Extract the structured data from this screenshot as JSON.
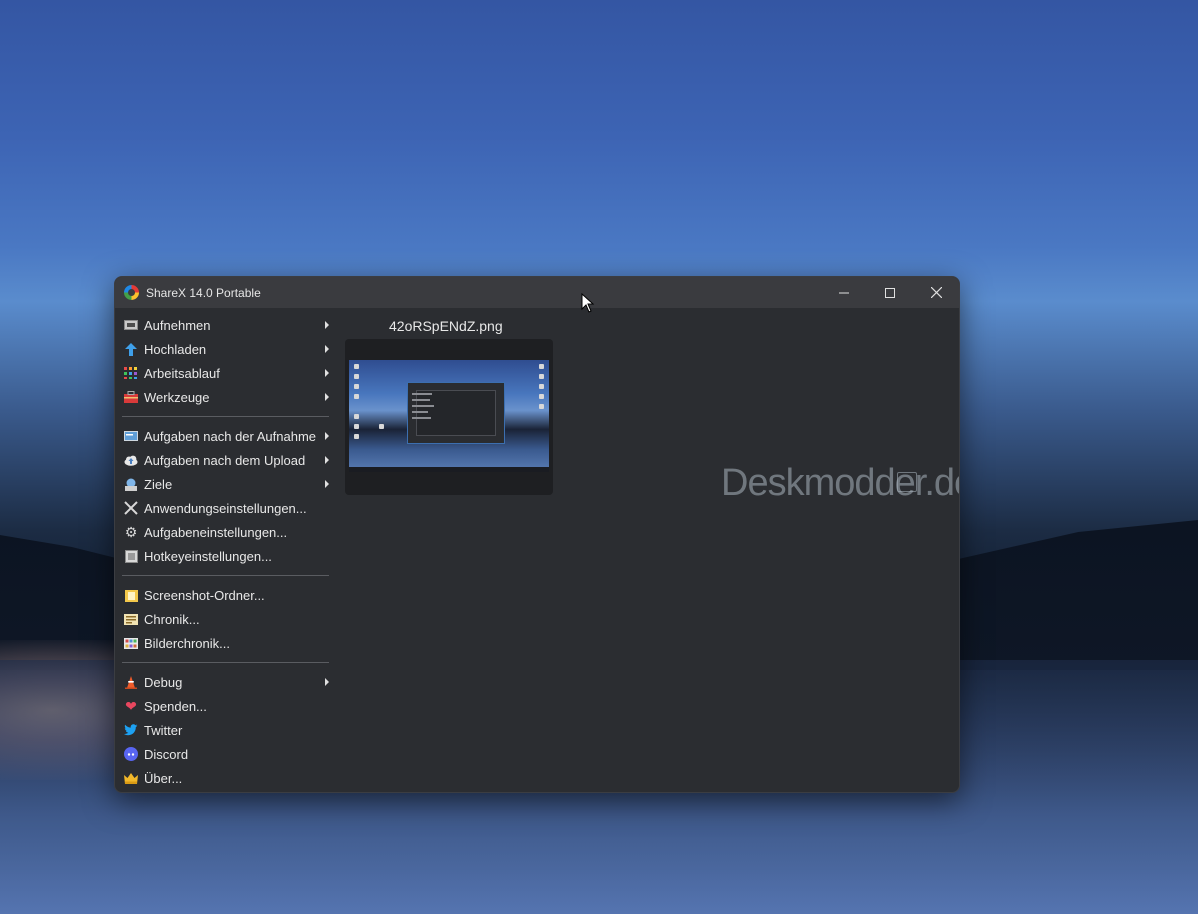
{
  "window": {
    "title": "ShareX 14.0 Portable",
    "controls": [
      "minimize",
      "maximize",
      "close"
    ]
  },
  "menu": {
    "groups": [
      [
        {
          "label": "Aufnehmen",
          "icon": "capture-icon",
          "submenu": true
        },
        {
          "label": "Hochladen",
          "icon": "upload-arrow-icon",
          "submenu": true
        },
        {
          "label": "Arbeitsablauf",
          "icon": "workflow-grid-icon",
          "submenu": true
        },
        {
          "label": "Werkzeuge",
          "icon": "toolbox-icon",
          "submenu": true
        }
      ],
      [
        {
          "label": "Aufgaben nach der Aufnahme",
          "icon": "after-capture-icon",
          "submenu": true
        },
        {
          "label": "Aufgaben nach dem Upload",
          "icon": "cloud-icon",
          "submenu": true
        },
        {
          "label": "Ziele",
          "icon": "destinations-icon",
          "submenu": true
        },
        {
          "label": "Anwendungseinstellungen...",
          "icon": "tools-icon",
          "submenu": false
        },
        {
          "label": "Aufgabeneinstellungen...",
          "icon": "gear-icon",
          "submenu": false
        },
        {
          "label": "Hotkeyeinstellungen...",
          "icon": "keyboard-icon",
          "submenu": false
        }
      ],
      [
        {
          "label": "Screenshot-Ordner...",
          "icon": "folder-icon",
          "submenu": false
        },
        {
          "label": "Chronik...",
          "icon": "history-icon",
          "submenu": false
        },
        {
          "label": "Bilderchronik...",
          "icon": "image-history-icon",
          "submenu": false
        }
      ],
      [
        {
          "label": "Debug",
          "icon": "traffic-cone-icon",
          "submenu": true
        },
        {
          "label": "Spenden...",
          "icon": "heart-icon",
          "submenu": false
        },
        {
          "label": "Twitter",
          "icon": "twitter-icon",
          "submenu": false
        },
        {
          "label": "Discord",
          "icon": "discord-icon",
          "submenu": false
        },
        {
          "label": "Über...",
          "icon": "crown-icon",
          "submenu": false
        }
      ]
    ]
  },
  "content": {
    "filename": "42oRSpENdZ.png"
  },
  "watermark": "Deskmodder.de"
}
